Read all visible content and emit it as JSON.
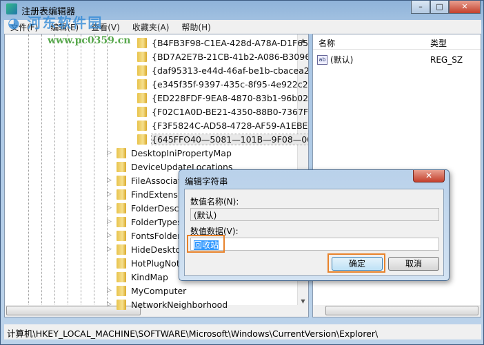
{
  "window": {
    "title": "注册表编辑器",
    "minimize": "–",
    "maximize": "□",
    "close": "✕"
  },
  "menu": [
    "文件(F)",
    "编辑(E)",
    "查看(V)",
    "收藏夹(A)",
    "帮助(H)"
  ],
  "watermark": {
    "brand": "河东软件园",
    "url": "www.pc0359.cn"
  },
  "tree": {
    "subkeys": [
      "{B4FB3F98-C1EA-428d-A78A-D1F65",
      "{BD7A2E7B-21CB-41b2-A086-B3096",
      "{daf95313-e44d-46af-be1b-cbacea2",
      "{e345f35f-9397-435c-8f95-4e922c26",
      "{ED228FDF-9EA8-4870-83b1-96b020",
      "{F02C1A0D-BE21-4350-88B0-7367F0",
      "{F3F5824C-AD58-4728-AF59-A1EBE3",
      "{645FFO40—5081—101B—9F08—00"
    ],
    "keys": [
      "DesktopIniPropertyMap",
      "DeviceUpdateLocations",
      "FileAssociations",
      "FindExtensions",
      "FolderDescriptions",
      "FolderTypes",
      "FontsFolder",
      "HideDesktopIcons",
      "HotPlugNotification",
      "KindMap",
      "MyComputer",
      "NetworkNeighborhood"
    ]
  },
  "list": {
    "col_name": "名称",
    "col_type": "类型",
    "rows": [
      {
        "icon": "ab-string-icon",
        "name": "(默认)",
        "type": "REG_SZ"
      }
    ]
  },
  "status": "计算机\\HKEY_LOCAL_MACHINE\\SOFTWARE\\Microsoft\\Windows\\CurrentVersion\\Explorer\\",
  "dialog": {
    "title": "编辑字符串",
    "close": "✕",
    "name_label": "数值名称(N):",
    "name_value": "(默认)",
    "data_label": "数值数据(V):",
    "data_value": "回收站",
    "ok": "确定",
    "cancel": "取消",
    "highlight_color": "#e8822a"
  }
}
